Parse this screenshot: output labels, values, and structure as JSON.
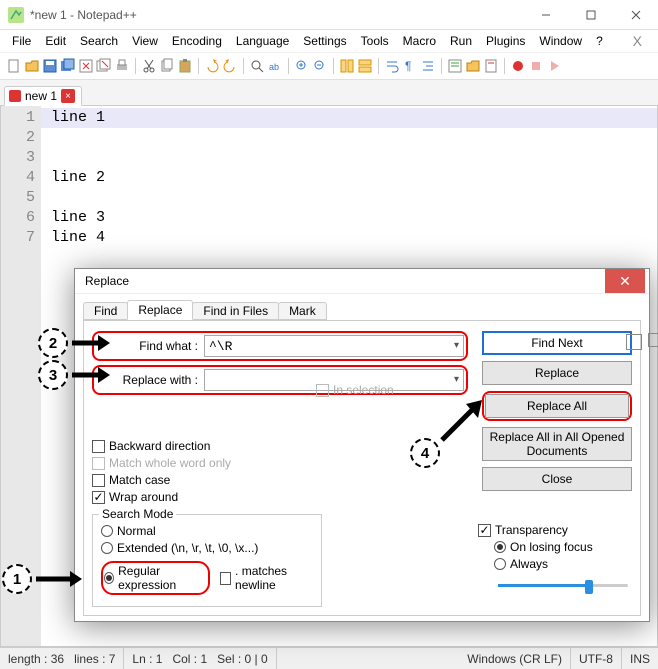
{
  "window": {
    "title": "*new 1 - Notepad++"
  },
  "menu": {
    "file": "File",
    "edit": "Edit",
    "search": "Search",
    "view": "View",
    "encoding": "Encoding",
    "language": "Language",
    "settings": "Settings",
    "tools": "Tools",
    "macro": "Macro",
    "run": "Run",
    "plugins": "Plugins",
    "window": "Window",
    "help": "?"
  },
  "filetab": {
    "name": "new 1"
  },
  "editor": {
    "lines": [
      "line 1",
      "",
      "",
      "line 2",
      "",
      "line 3",
      "line 4"
    ]
  },
  "dialog": {
    "title": "Replace",
    "tabs": {
      "find": "Find",
      "replace": "Replace",
      "findinfiles": "Find in Files",
      "mark": "Mark"
    },
    "findwhat_label": "Find what :",
    "findwhat_value": "^\\R",
    "replacewith_label": "Replace with :",
    "replacewith_value": "",
    "inselection": "In selection",
    "btn_findnext": "Find Next",
    "btn_replace": "Replace",
    "btn_replaceall": "Replace All",
    "btn_replaceall_open": "Replace All in All Opened Documents",
    "btn_close": "Close",
    "opt_backward": "Backward direction",
    "opt_whole": "Match whole word only",
    "opt_case": "Match case",
    "opt_wrap": "Wrap around",
    "searchmode_legend": "Search Mode",
    "mode_normal": "Normal",
    "mode_extended": "Extended (\\n, \\r, \\t, \\0, \\x...)",
    "mode_regex": "Regular expression",
    "mode_dotnl": ". matches newline",
    "transp_label": "Transparency",
    "transp_onlose": "On losing focus",
    "transp_always": "Always"
  },
  "status": {
    "length": "length : 36",
    "lines": "lines : 7",
    "ln": "Ln : 1",
    "col": "Col : 1",
    "sel": "Sel : 0 | 0",
    "eol": "Windows (CR LF)",
    "enc": "UTF-8",
    "ins": "INS"
  },
  "callouts": {
    "c1": "1",
    "c2": "2",
    "c3": "3",
    "c4": "4"
  }
}
